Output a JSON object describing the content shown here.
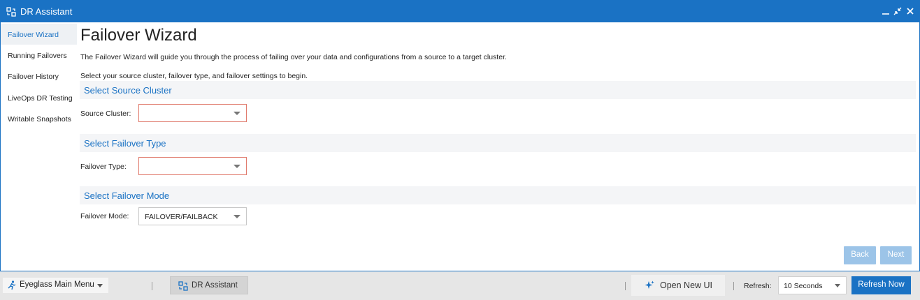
{
  "window": {
    "title": "DR Assistant",
    "icon": "dr-assistant-icon",
    "controls": [
      "minimize-icon",
      "restore-icon",
      "close-icon"
    ]
  },
  "sidebar": {
    "items": [
      {
        "label": "Failover Wizard",
        "active": true
      },
      {
        "label": "Running Failovers",
        "active": false
      },
      {
        "label": "Failover History",
        "active": false
      },
      {
        "label": "LiveOps DR Testing",
        "active": false
      },
      {
        "label": "Writable Snapshots",
        "active": false
      }
    ]
  },
  "main": {
    "title": "Failover Wizard",
    "description_1": "The Failover Wizard will guide you through the process of failing over your data and configurations from a source to a target cluster.",
    "description_2": "Select your source cluster, failover type, and failover settings to begin.",
    "sections": [
      {
        "header": "Select Source Cluster",
        "field_label": "Source Cluster:",
        "value": "",
        "error": true
      },
      {
        "header": "Select Failover Type",
        "field_label": "Failover Type:",
        "value": "",
        "error": true
      },
      {
        "header": "Select Failover Mode",
        "field_label": "Failover Mode:",
        "value": "FAILOVER/FAILBACK",
        "error": false
      }
    ],
    "buttons": {
      "back": "Back",
      "next": "Next"
    }
  },
  "taskbar": {
    "main_menu": "Eyeglass Main Menu",
    "active_task": "DR Assistant",
    "open_new_ui": "Open New UI",
    "refresh_label": "Refresh:",
    "refresh_value": "10 Seconds",
    "refresh_now": "Refresh Now"
  },
  "colors": {
    "accent": "#1a72c4",
    "disabled_button": "#9cc4e8",
    "error_border": "#e07a6c",
    "section_bg": "#f4f5f7"
  }
}
